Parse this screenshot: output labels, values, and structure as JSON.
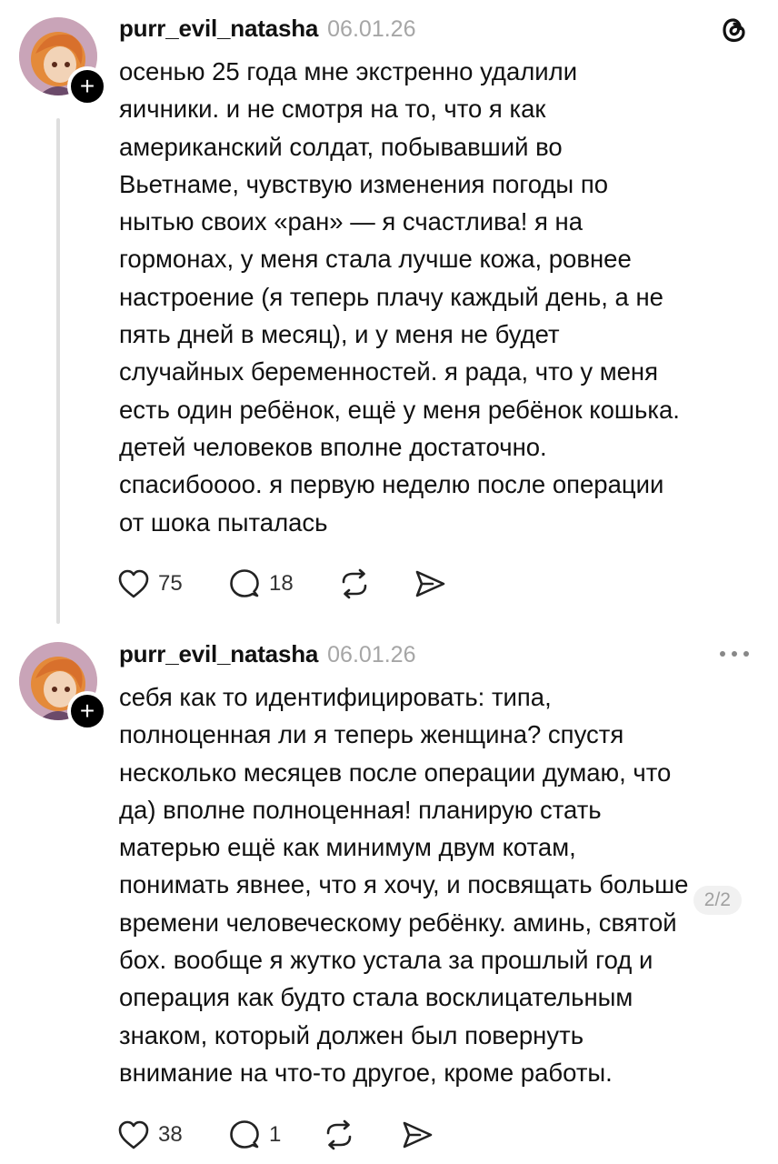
{
  "posts": [
    {
      "username": "purr_evil_natasha",
      "date": "06.01.26",
      "text_lines": [
        "осенью 25 года мне экстренно удалили",
        "яичники. и не смотря на то, что я как",
        "американский солдат, побывавший во",
        "Вьетнаме, чувствую изменения погоды по",
        "нытью своих «ран» — я счастлива! я на",
        "гормонах, у меня стала лучше кожа, ровнее",
        "настроение (я теперь плачу каждый день, а не",
        "пять дней в месяц), и у меня не будет",
        "случайных беременностей. я рада, что у меня",
        "есть один ребёнок, ещё у меня ребёнок кошька.",
        "детей человеков вполне достаточно.",
        "спасибоооо. я первую неделю после операции",
        "от шока пыталась"
      ],
      "likes": "75",
      "replies": "18",
      "top_icon": "threads-logo-icon"
    },
    {
      "username": "purr_evil_natasha",
      "date": "06.01.26",
      "text_lines": [
        "себя как то идентифицировать: типа,",
        "полноценная ли я теперь женщина? спустя",
        "несколько месяцев после операции думаю, что",
        "да) вполне полноценная! планирую стать",
        "матерью ещё как минимум двум котам,",
        "понимать явнее, что я хочу, и посвящать больше",
        "времени человеческому ребёнку. аминь, святой",
        "бох. вообще я жутко устала за прошлый год и",
        "операция как будто стала восклицательным",
        "знаком, который должен был повернуть",
        "внимание на что-то другое, кроме работы."
      ],
      "page_indicator": "2/2",
      "likes": "38",
      "replies": "1",
      "top_icon": "more-options-icon"
    }
  ],
  "icons": {
    "follow": "+",
    "like": "heart-icon",
    "reply": "comment-icon",
    "repost": "repost-icon",
    "share": "share-icon"
  }
}
